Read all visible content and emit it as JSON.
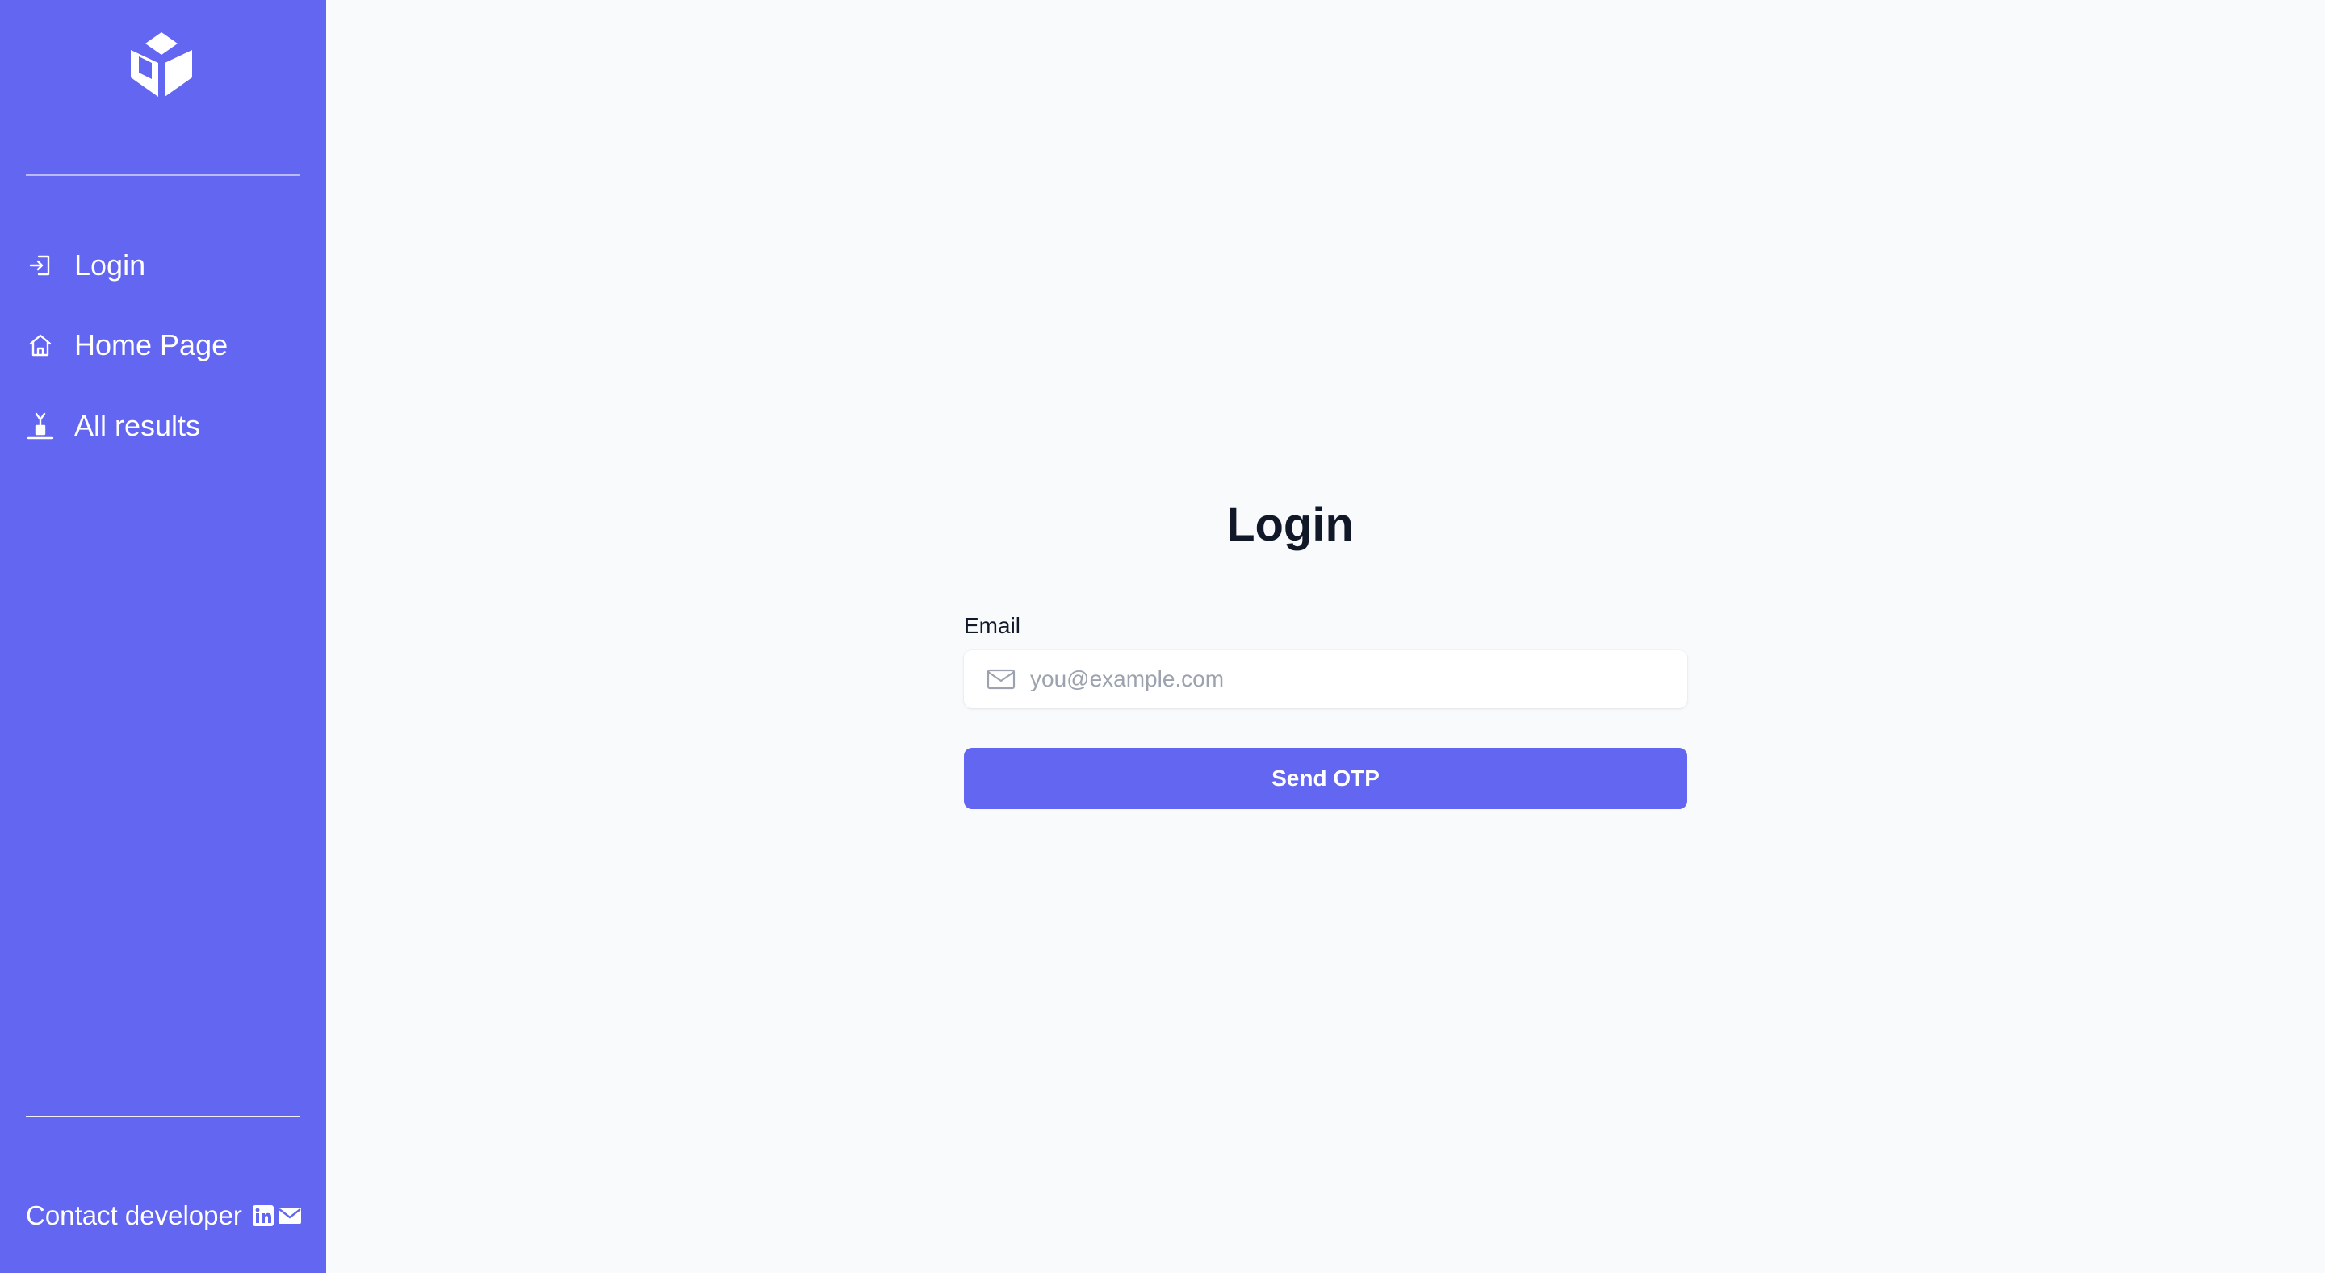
{
  "sidebar": {
    "logo_icon": "cube-logo-icon",
    "items": [
      {
        "label": "Login",
        "icon": "login-icon"
      },
      {
        "label": "Home Page",
        "icon": "home-icon"
      },
      {
        "label": "All results",
        "icon": "results-icon"
      }
    ],
    "contact": {
      "label": "Contact developer",
      "icons": [
        "linkedin-icon",
        "mail-icon"
      ]
    }
  },
  "main": {
    "title": "Login",
    "email": {
      "label": "Email",
      "placeholder": "you@example.com",
      "value": "",
      "icon": "envelope-icon"
    },
    "submit_label": "Send OTP"
  },
  "colors": {
    "accent": "#6366f1",
    "background": "#f9fafb",
    "text": "#111827",
    "placeholder": "#9ca3af"
  }
}
